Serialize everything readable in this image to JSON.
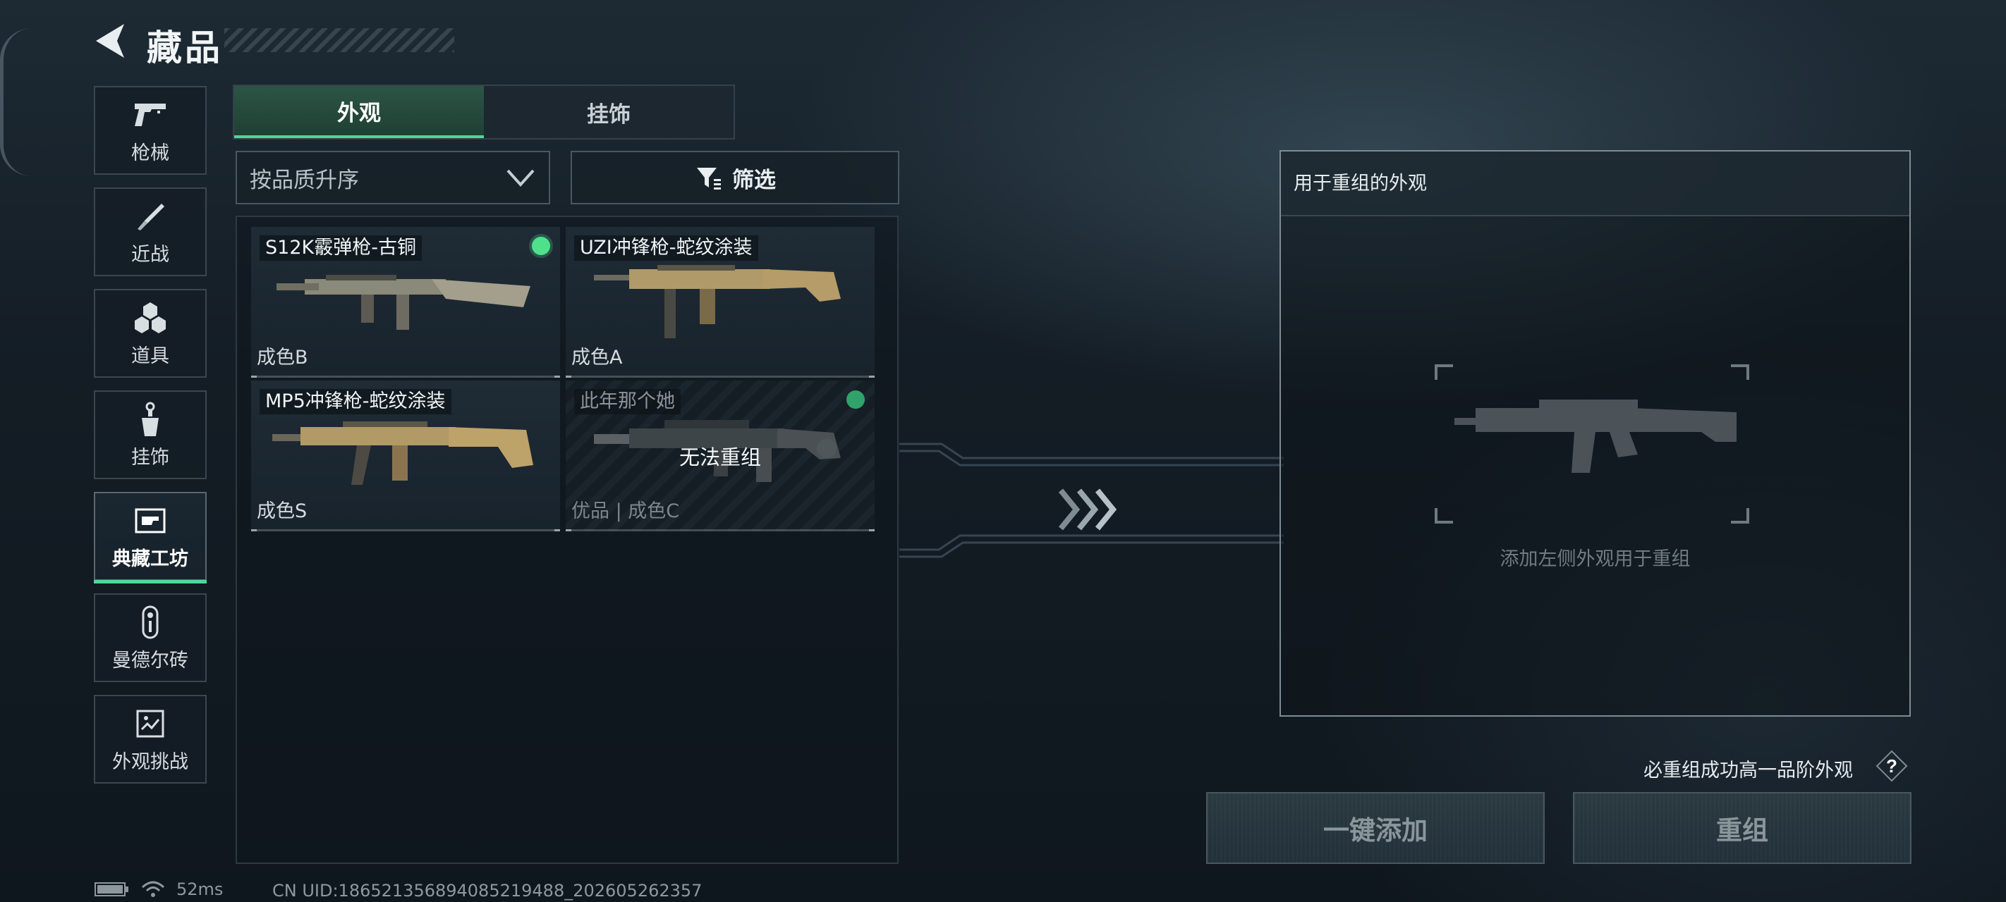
{
  "header": {
    "title": "藏品"
  },
  "sidebar": {
    "items": [
      {
        "label": "枪械",
        "icon": "pistol-icon",
        "active": false
      },
      {
        "label": "近战",
        "icon": "knife-icon",
        "active": false
      },
      {
        "label": "道具",
        "icon": "grenades-icon",
        "active": false
      },
      {
        "label": "挂饰",
        "icon": "charm-icon",
        "active": false
      },
      {
        "label": "典藏工坊",
        "icon": "workshop-icon",
        "active": true
      },
      {
        "label": "曼德尔砖",
        "icon": "mandel-brick-icon",
        "active": false
      },
      {
        "label": "外观挑战",
        "icon": "challenge-icon",
        "active": false
      }
    ]
  },
  "tabs": [
    {
      "label": "外观",
      "active": true
    },
    {
      "label": "挂饰",
      "active": false
    }
  ],
  "sort": {
    "selected": "按品质升序"
  },
  "filter": {
    "label": "筛选"
  },
  "skins": [
    {
      "name": "S12K霰弹枪-古铜",
      "grade": "成色B",
      "selected": true,
      "disabled": false
    },
    {
      "name": "UZI冲锋枪-蛇纹涂装",
      "grade": "成色A",
      "selected": false,
      "disabled": false
    },
    {
      "name": "MP5冲锋枪-蛇纹涂装",
      "grade": "成色S",
      "selected": false,
      "disabled": false
    },
    {
      "name": "此年那个她",
      "grade": "优品 | 成色C",
      "selected": true,
      "disabled": true,
      "overlay": "无法重组"
    }
  ],
  "reforge": {
    "title": "用于重组的外观",
    "hint": "添加左侧外观用于重组",
    "guarantee": "必重组成功高一品阶外观",
    "add_all_label": "一键添加",
    "reforge_label": "重组"
  },
  "status": {
    "ping": "52ms",
    "uid": "CN UID:1865213568940852194​88_202605262357"
  },
  "colors": {
    "accent": "#4fd699",
    "selected_dot": "#4fe08c"
  }
}
